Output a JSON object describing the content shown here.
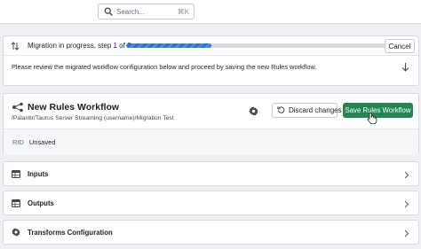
{
  "search": {
    "placeholder": "Search...",
    "shortcut": "⌘K"
  },
  "migration": {
    "title": "Migration in progress, step 1 of 3",
    "progress_fraction": 0.33,
    "cancel_label": "Cancel",
    "message": "Please review the migrated workflow configuration below and proceed by saving the new Rules workflow."
  },
  "workflow": {
    "title": "New Rules Workflow",
    "path": "/Palantir/Taurus Server Streaming (username)/Migration Test",
    "discard_label": "Discard changes",
    "save_label": "Save Rules Workflow",
    "rid_label": "RID",
    "rid_value": "Unsaved"
  },
  "sections": [
    {
      "label": "Inputs",
      "icon": "table-icon"
    },
    {
      "label": "Outputs",
      "icon": "table-icon"
    },
    {
      "label": "Transforms Configuration",
      "icon": "gear-icon"
    }
  ],
  "colors": {
    "accent": "#2d72d2",
    "save": "#238551"
  }
}
